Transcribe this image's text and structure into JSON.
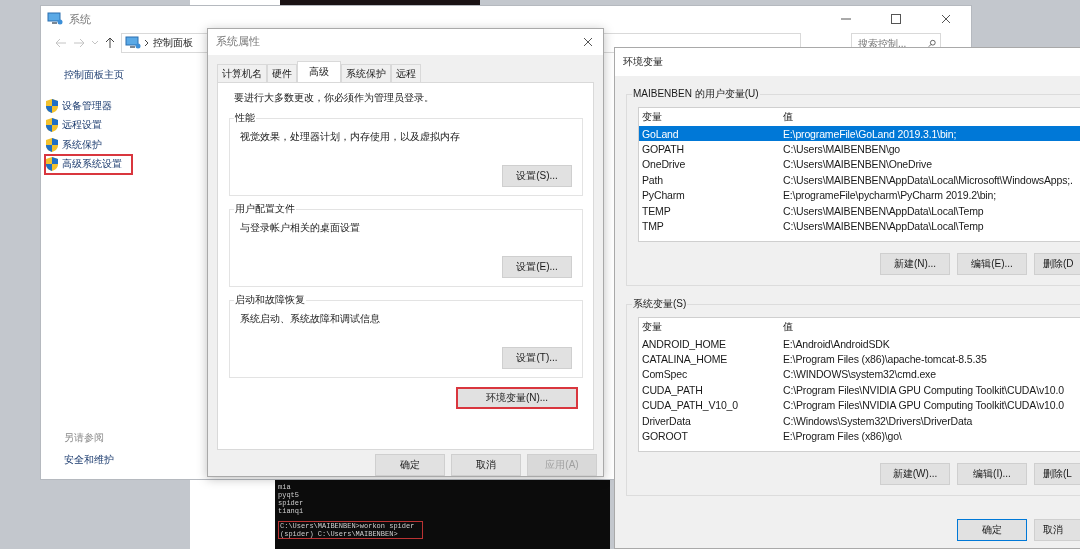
{
  "system_window": {
    "title": "系统",
    "breadcrumb": "控制面板",
    "search": {
      "placeholder": "搜索控制..."
    },
    "sidebar": {
      "home": "控制面板主页",
      "items": [
        {
          "label": "设备管理器",
          "highlighted": false
        },
        {
          "label": "远程设置",
          "highlighted": false
        },
        {
          "label": "系统保护",
          "highlighted": false
        },
        {
          "label": "高级系统设置",
          "highlighted": true
        }
      ]
    },
    "see_also": {
      "heading": "另请参阅",
      "links": [
        "安全和维护"
      ]
    }
  },
  "terminal": {
    "lines": [
      "mia",
      "pyqt5",
      "spider",
      "tianqi"
    ],
    "highlighted_block": [
      "C:\\Users\\MAIBENBEN>workon spider",
      "(spider) C:\\Users\\MAIBENBEN>"
    ]
  },
  "system_properties": {
    "title": "系统属性",
    "tabs": [
      {
        "label": "计算机名",
        "selected": false
      },
      {
        "label": "硬件",
        "selected": false
      },
      {
        "label": "高级",
        "selected": true
      },
      {
        "label": "系统保护",
        "selected": false
      },
      {
        "label": "远程",
        "selected": false
      }
    ],
    "notice": "要进行大多数更改，你必须作为管理员登录。",
    "groups": [
      {
        "title": "性能",
        "description": "视觉效果，处理器计划，内存使用，以及虚拟内存",
        "button": "设置(S)..."
      },
      {
        "title": "用户配置文件",
        "description": "与登录帐户相关的桌面设置",
        "button": "设置(E)..."
      },
      {
        "title": "启动和故障恢复",
        "description": "系统启动、系统故障和调试信息",
        "button": "设置(T)..."
      }
    ],
    "env_button": {
      "label": "环境变量(N)...",
      "highlighted": true
    },
    "buttons": [
      {
        "label": "确定",
        "disabled": false
      },
      {
        "label": "取消",
        "disabled": false
      },
      {
        "label": "应用(A)",
        "disabled": true
      }
    ]
  },
  "environment_variables": {
    "title": "环境变量",
    "user_vars": {
      "title": "MAIBENBEN 的用户变量(U)",
      "columns": [
        "变量",
        "值"
      ],
      "rows": [
        {
          "name": "GoLand",
          "value": "E:\\programeFile\\GoLand 2019.3.1\\bin;",
          "selected": true
        },
        {
          "name": "GOPATH",
          "value": "C:\\Users\\MAIBENBEN\\go",
          "selected": false
        },
        {
          "name": "OneDrive",
          "value": "C:\\Users\\MAIBENBEN\\OneDrive",
          "selected": false
        },
        {
          "name": "Path",
          "value": "C:\\Users\\MAIBENBEN\\AppData\\Local\\Microsoft\\WindowsApps;.",
          "selected": false
        },
        {
          "name": "PyCharm",
          "value": "E:\\programeFile\\pycharm\\PyCharm 2019.2\\bin;",
          "selected": false
        },
        {
          "name": "TEMP",
          "value": "C:\\Users\\MAIBENBEN\\AppData\\Local\\Temp",
          "selected": false
        },
        {
          "name": "TMP",
          "value": "C:\\Users\\MAIBENBEN\\AppData\\Local\\Temp",
          "selected": false
        }
      ],
      "buttons": [
        "新建(N)...",
        "编辑(E)...",
        "删除(D"
      ]
    },
    "system_vars": {
      "title": "系统变量(S)",
      "columns": [
        "变量",
        "值"
      ],
      "rows": [
        {
          "name": "ANDROID_HOME",
          "value": "E:\\Android\\AndroidSDK",
          "selected": false
        },
        {
          "name": "CATALINA_HOME",
          "value": "E:\\Program Files (x86)\\apache-tomcat-8.5.35",
          "selected": false
        },
        {
          "name": "ComSpec",
          "value": "C:\\WINDOWS\\system32\\cmd.exe",
          "selected": false
        },
        {
          "name": "CUDA_PATH",
          "value": "C:\\Program Files\\NVIDIA GPU Computing Toolkit\\CUDA\\v10.0",
          "selected": false
        },
        {
          "name": "CUDA_PATH_V10_0",
          "value": "C:\\Program Files\\NVIDIA GPU Computing Toolkit\\CUDA\\v10.0",
          "selected": false
        },
        {
          "name": "DriverData",
          "value": "C:\\Windows\\System32\\Drivers\\DriverData",
          "selected": false
        },
        {
          "name": "GOROOT",
          "value": "E:\\Program Files (x86)\\go\\",
          "selected": false
        }
      ],
      "buttons": [
        "新建(W)...",
        "编辑(I)...",
        "删除(L"
      ]
    },
    "buttons": [
      "确定",
      "取消"
    ]
  }
}
